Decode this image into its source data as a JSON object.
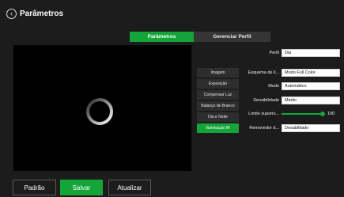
{
  "header": {
    "title": "Parâmetros",
    "back_icon": "chevron-left-icon"
  },
  "tabs": [
    {
      "label": "Parâmetros",
      "active": true
    },
    {
      "label": "Gerenciar Perfil",
      "active": false
    }
  ],
  "menu": [
    {
      "label": "Imagem",
      "active": false
    },
    {
      "label": "Exposição",
      "active": false
    },
    {
      "label": "Compensar Luz",
      "active": false
    },
    {
      "label": "Balanço de Branco",
      "active": false
    },
    {
      "label": "Dia e Noite",
      "active": false
    },
    {
      "label": "Iluminação IR",
      "active": true
    }
  ],
  "form": {
    "perfil": {
      "label": "Perfil",
      "value": "Dia"
    },
    "esquema": {
      "label": "Esquema de il...",
      "value": "Modo Full Color"
    },
    "modo": {
      "label": "Modo",
      "value": "Automático"
    },
    "sensibilidade": {
      "label": "Sensibilidade",
      "value": "Médio"
    },
    "limite": {
      "label": "Limite superio...",
      "value": "100",
      "level": 1.0
    },
    "removedor": {
      "label": "Removedor d...",
      "value": "Desabilitado"
    }
  },
  "footer": {
    "default_label": "Padrão",
    "save_label": "Salvar",
    "refresh_label": "Atualizar"
  },
  "colors": {
    "accent": "#13a538",
    "background": "#1c1c1c",
    "video": "#000000"
  }
}
